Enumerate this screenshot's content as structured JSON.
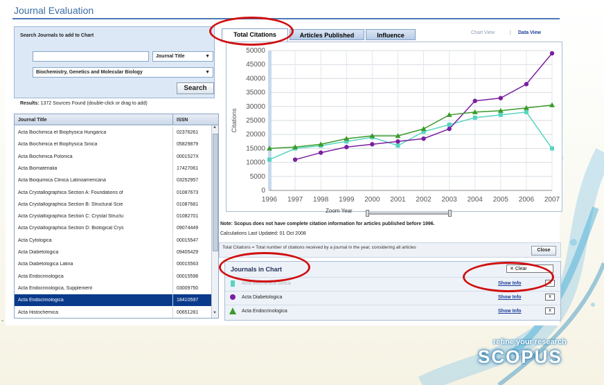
{
  "window": {
    "title": "Journal Evaluation"
  },
  "search": {
    "heading": "Search Journals to add to Chart",
    "query_value": "",
    "field_select": "Journal Title",
    "subject_select": "Biochemistry, Genetics and Molecular Biology",
    "search_button": "Search"
  },
  "results": {
    "summary_label": "Results:",
    "summary_text": "1372 Sources Found (double-click or drag to add)",
    "col_title": "Journal Title",
    "col_issn": "ISSN",
    "rows": [
      {
        "title": "Acta Biochimica et Biophysica Hungarica",
        "issn": "02376261"
      },
      {
        "title": "Acta Biochimica et Biophysica Sinica",
        "issn": "05829879"
      },
      {
        "title": "Acta Biochimica Polonica",
        "issn": "0001527X"
      },
      {
        "title": "Acta Biomaterialia",
        "issn": "17427061"
      },
      {
        "title": "Acta Bioquimica Clinica Latinoamericana",
        "issn": "03252957"
      },
      {
        "title": "Acta Crystallographica Section A: Foundations of",
        "issn": "01087673"
      },
      {
        "title": "Acta Crystallographica Section B: Structural Scie",
        "issn": "01087681"
      },
      {
        "title": "Acta Crystallographica Section C: Crystal Structu",
        "issn": "01082701"
      },
      {
        "title": "Acta Crystallographica Section D: Biological Crys",
        "issn": "09074449"
      },
      {
        "title": "Acta Cytologica",
        "issn": "00015547"
      },
      {
        "title": "Acta Diabetologica",
        "issn": "09405429"
      },
      {
        "title": "Acta Diabetologica Latina",
        "issn": "00015563"
      },
      {
        "title": "Acta Endocrinologica",
        "issn": "00015598"
      },
      {
        "title": "Acta Endocrinologica, Supplement",
        "issn": "03009750"
      },
      {
        "title": "Acta Endocrinologica",
        "issn": "18410597"
      },
      {
        "title": "Acta Histochemica",
        "issn": "00651281"
      }
    ],
    "selected_index": 14
  },
  "tabs": {
    "items": [
      "Total Citations",
      "Articles Published",
      "Influence"
    ],
    "active_index": 0
  },
  "views": {
    "chart_view": "Chart View",
    "data_view": "Data View",
    "separator": "|"
  },
  "chart_data": {
    "type": "line",
    "ylabel": "Citations",
    "x": [
      "1996",
      "1997",
      "1998",
      "1999",
      "2000",
      "2001",
      "2002",
      "2003",
      "2004",
      "2005",
      "2006",
      "2007"
    ],
    "yticks": [
      0,
      5000,
      10000,
      15000,
      20000,
      25000,
      30000,
      35000,
      40000,
      45000,
      50000
    ],
    "ylim": [
      0,
      50000
    ],
    "grid": true,
    "series": [
      {
        "color": "#55d4c0",
        "marker": "square",
        "values": [
          11000,
          15000,
          16000,
          17500,
          19000,
          16000,
          21000,
          23500,
          26000,
          27000,
          28000,
          15000
        ]
      },
      {
        "color": "#7a1fa0",
        "marker": "circle",
        "values": [
          null,
          11000,
          13500,
          15500,
          16500,
          17500,
          18500,
          22000,
          32000,
          33000,
          38000,
          49000
        ]
      },
      {
        "color": "#3a9a2a",
        "marker": "triangle",
        "values": [
          15000,
          15500,
          16500,
          18500,
          19500,
          19500,
          22000,
          27000,
          28000,
          28500,
          29500,
          30500
        ]
      }
    ]
  },
  "zoom": {
    "label": "Zoom Year"
  },
  "notes": {
    "note_text": "Note: Scopus does not have complete citation information for articles published before 1996.",
    "calc_text": "Calculations Last Updated: 01 Oct 2008",
    "definition_text": "Total Citations = Total number of citations received by a journal in the year, considering all articles",
    "close_button": "Close"
  },
  "journals_in_chart": {
    "heading": "Journals in Chart",
    "clear_label": "Clear",
    "items": [
      {
        "name": "Acta Biochimica Sinica",
        "color": "#55d4c0",
        "show_info": "Show Info",
        "remove": "x"
      },
      {
        "name": "Acta Diabetologica",
        "color": "#7a1fa0",
        "show_info": "Show Info",
        "remove": "x"
      },
      {
        "name": "Acta Endocrinologica",
        "color": "#3a9a2a",
        "show_info": "Show Info",
        "remove": "x"
      }
    ]
  },
  "branding": {
    "tagline": "refine your research",
    "logo": "SCOPUS"
  }
}
